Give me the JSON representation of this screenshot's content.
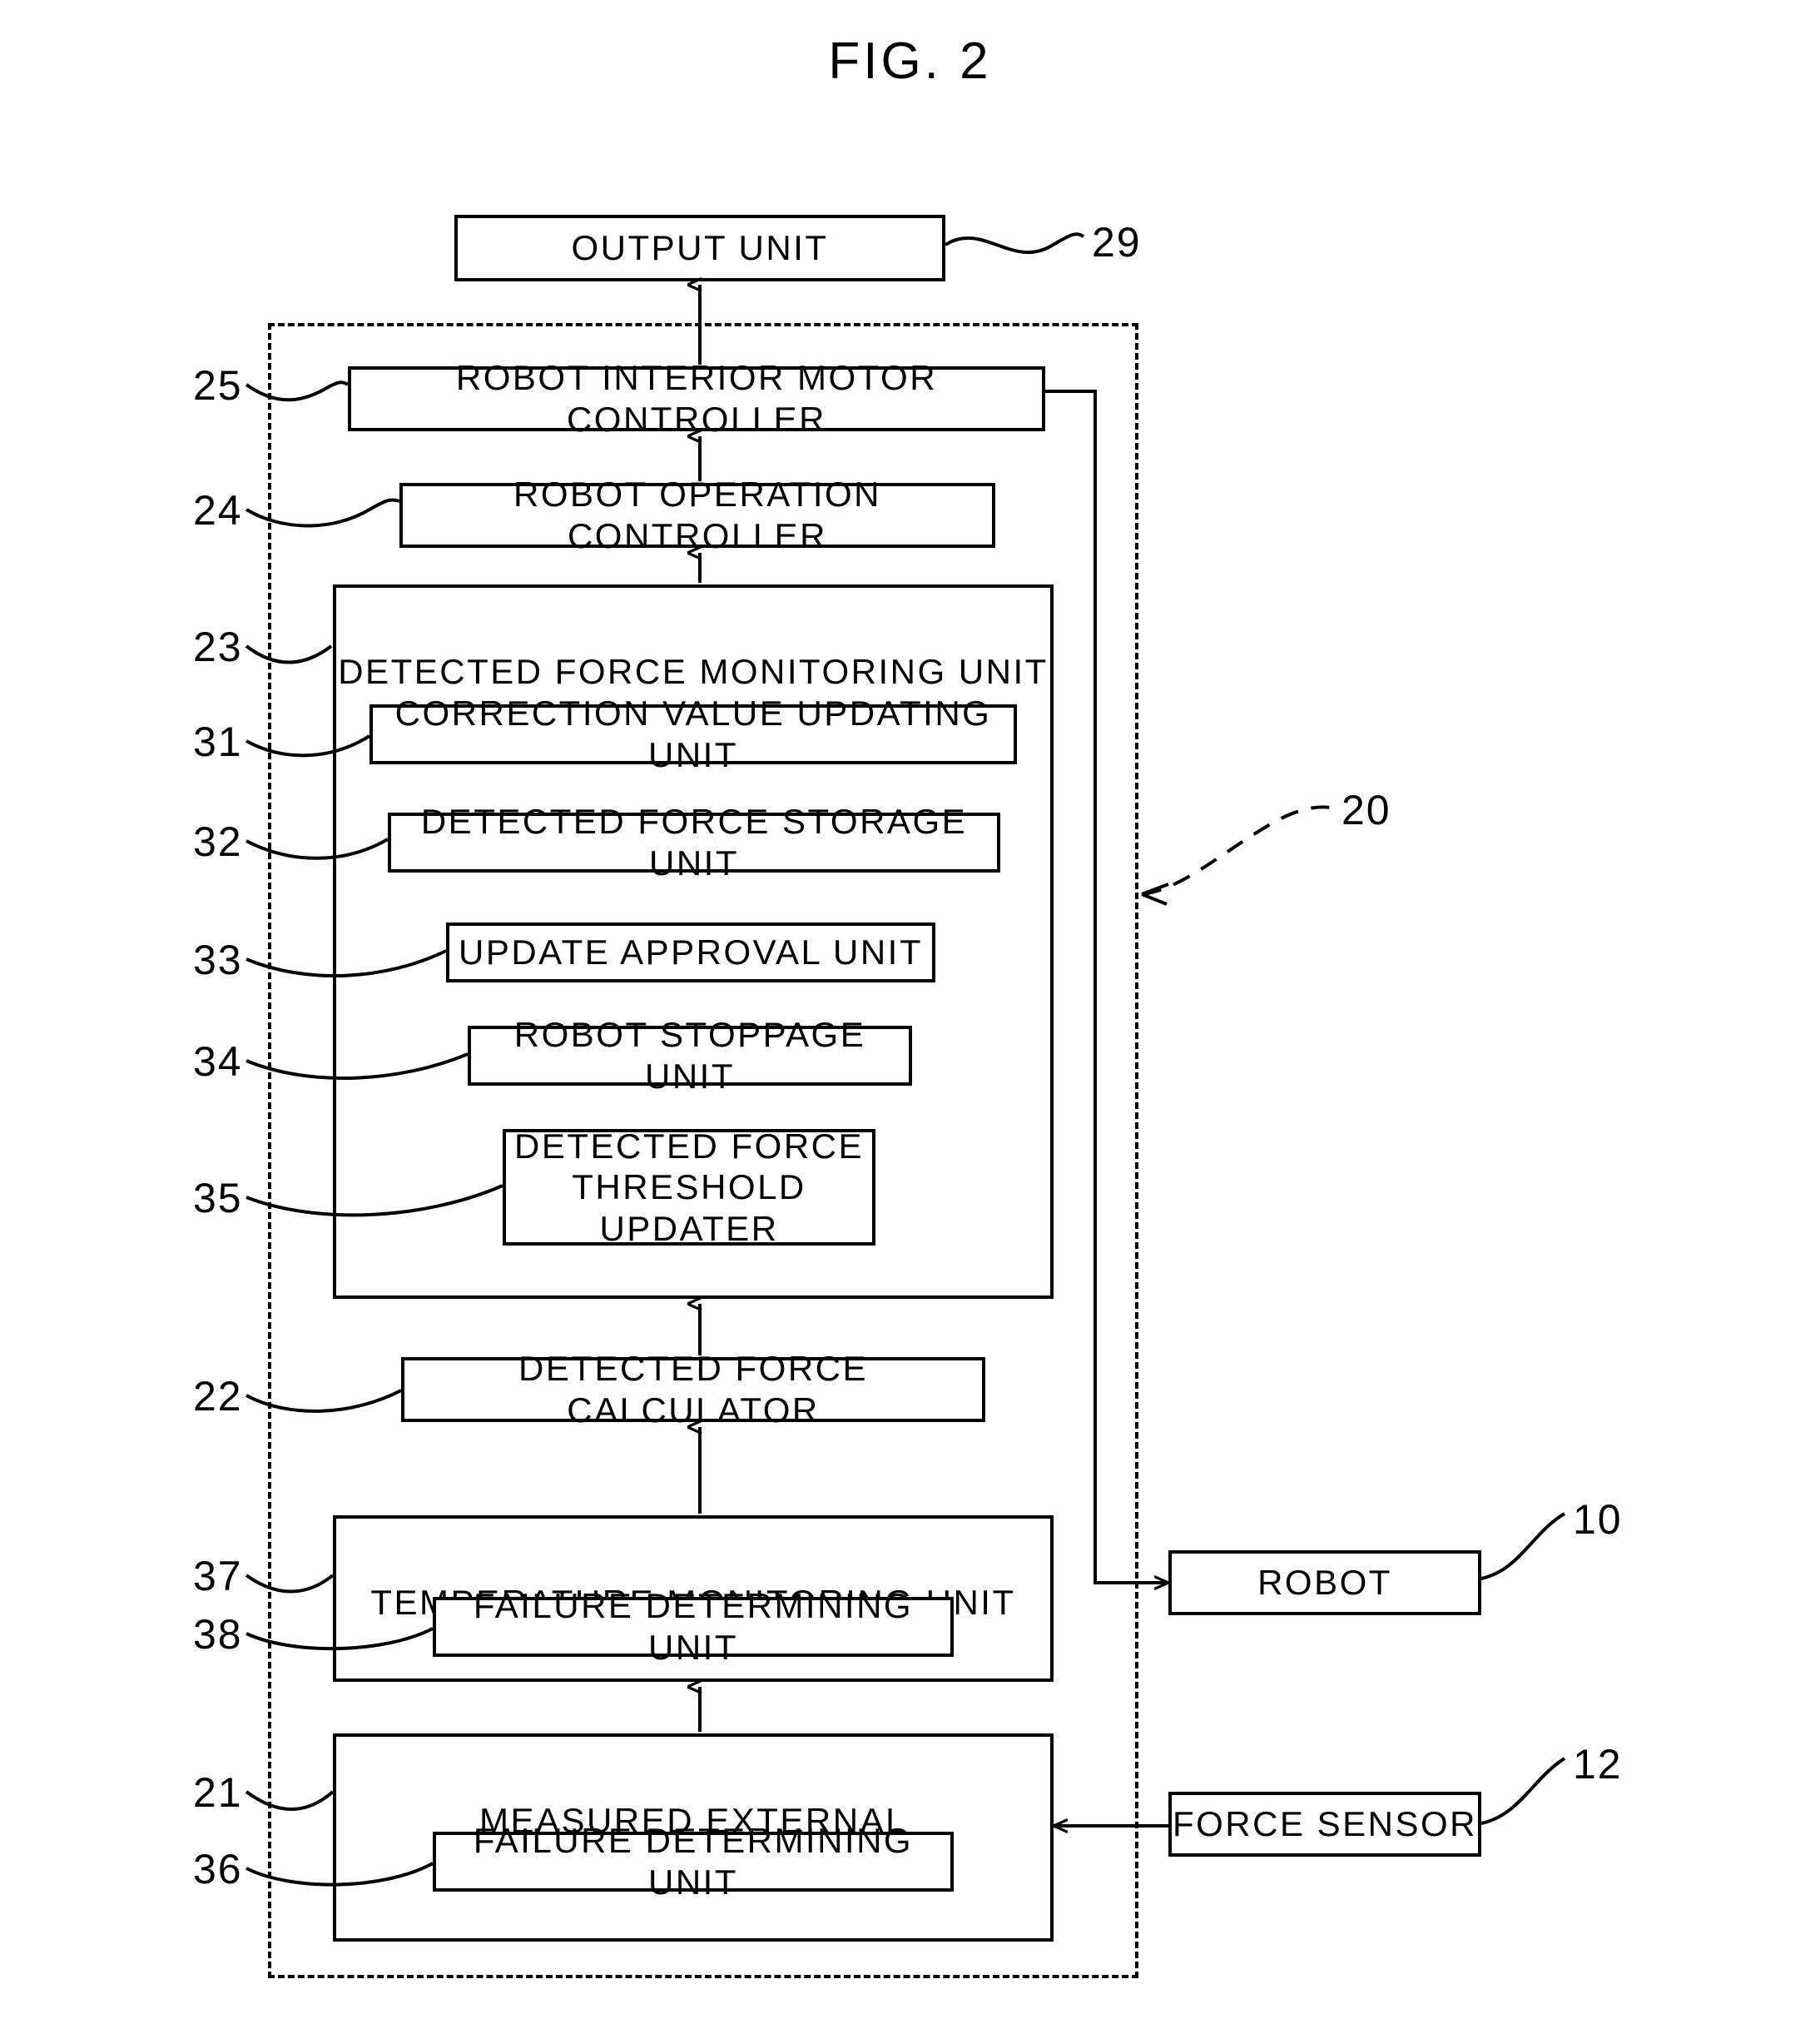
{
  "figure": {
    "title": "FIG. 2",
    "type": "patent-block-diagram"
  },
  "boxes": {
    "output_unit": {
      "label": "OUTPUT UNIT",
      "ref": "29"
    },
    "robot_interior_motor_controller": {
      "label": "ROBOT INTERIOR MOTOR CONTROLLER",
      "ref": "25"
    },
    "robot_operation_controller": {
      "label": "ROBOT OPERATION CONTROLLER",
      "ref": "24"
    },
    "detected_force_monitoring_unit": {
      "label": "DETECTED FORCE MONITORING UNIT",
      "ref": "23"
    },
    "correction_value_updating_unit": {
      "label": "CORRECTION VALUE UPDATING UNIT",
      "ref": "31"
    },
    "detected_force_storage_unit": {
      "label": "DETECTED FORCE STORAGE UNIT",
      "ref": "32"
    },
    "update_approval_unit": {
      "label": "UPDATE APPROVAL UNIT",
      "ref": "33"
    },
    "robot_stoppage_unit": {
      "label": "ROBOT STOPPAGE UNIT",
      "ref": "34"
    },
    "detected_force_threshold_updater": {
      "label": "DETECTED FORCE\nTHRESHOLD UPDATER",
      "ref": "35"
    },
    "detected_force_calculator": {
      "label": "DETECTED FORCE CALCULATOR",
      "ref": "22"
    },
    "temperature_monitoring_unit": {
      "label": "TEMPERATURE MONITORING UNIT",
      "ref": "37"
    },
    "failure_determining_unit_temp": {
      "label": "FAILURE DETERMINING UNIT",
      "ref": "38"
    },
    "measured_external_force_monitoring_unit": {
      "label": "MEASURED EXTERNAL\nFORCE MONITORING UNIT",
      "ref": "21"
    },
    "failure_determining_unit_force": {
      "label": "FAILURE DETERMINING UNIT",
      "ref": "36"
    },
    "robot": {
      "label": "ROBOT",
      "ref": "10"
    },
    "force_sensor": {
      "label": "FORCE SENSOR",
      "ref": "12"
    }
  },
  "system_boundary": {
    "ref": "20"
  },
  "colors": {
    "line": "#000000",
    "background": "#ffffff"
  }
}
